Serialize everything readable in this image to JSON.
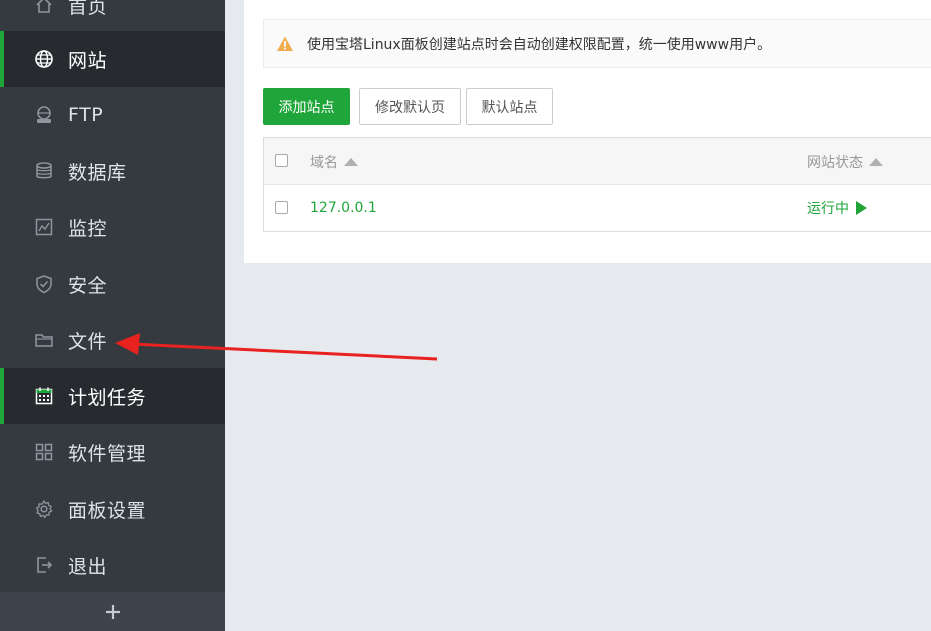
{
  "sidebar": {
    "items": [
      {
        "label": "首页",
        "icon": "home-icon"
      },
      {
        "label": "网站",
        "icon": "globe-icon",
        "active": true
      },
      {
        "label": "FTP",
        "icon": "ftp-icon"
      },
      {
        "label": "数据库",
        "icon": "database-icon"
      },
      {
        "label": "监控",
        "icon": "monitor-icon"
      },
      {
        "label": "安全",
        "icon": "shield-icon"
      },
      {
        "label": "文件",
        "icon": "folder-icon"
      },
      {
        "label": "计划任务",
        "icon": "calendar-icon",
        "active": true
      },
      {
        "label": "软件管理",
        "icon": "grid-icon"
      },
      {
        "label": "面板设置",
        "icon": "gear-icon"
      },
      {
        "label": "退出",
        "icon": "logout-icon"
      }
    ],
    "footer_icon": "plus-icon"
  },
  "notice": {
    "text": "使用宝塔Linux面板创建站点时会自动创建权限配置，统一使用www用户。",
    "icon": "warning-icon"
  },
  "toolbar": {
    "add_site": "添加站点",
    "edit_default_page": "修改默认页",
    "default_site": "默认站点"
  },
  "table": {
    "columns": [
      "域名",
      "网站状态"
    ],
    "rows": [
      {
        "domain": "127.0.0.1",
        "status": "运行中"
      }
    ]
  },
  "colors": {
    "sidebar_bg": "#343a40",
    "active_bg": "#272b30",
    "accent": "#20a53a",
    "warning": "#f0ad4e",
    "annotation_arrow": "#e8221f"
  }
}
